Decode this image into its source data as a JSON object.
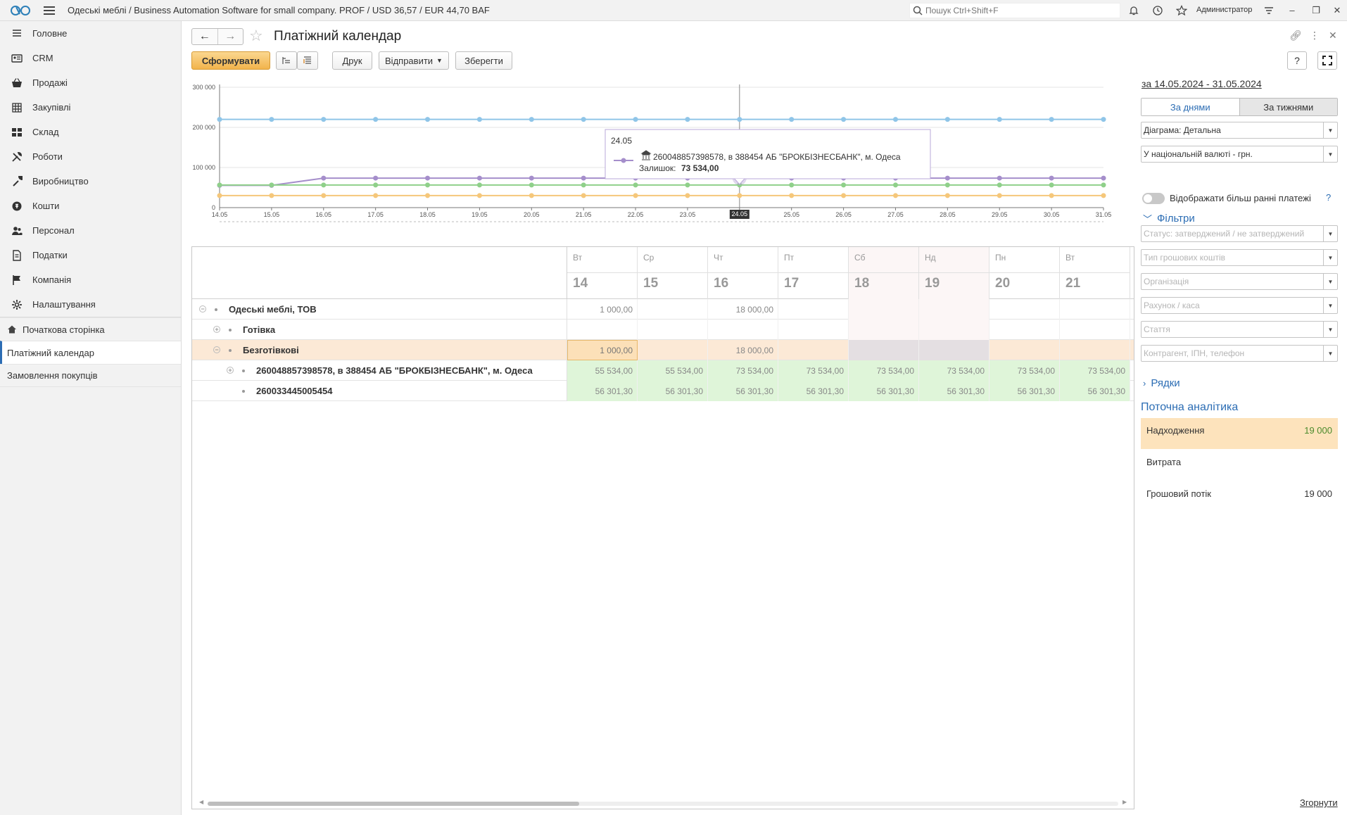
{
  "app": {
    "title": "Одеські меблі / Business Automation Software for small company. PROF / USD 36,57 / EUR 44,70 BAF",
    "search_placeholder": "Пошук Ctrl+Shift+F",
    "user": "Администратор"
  },
  "sidebar": {
    "sections": [
      {
        "label": "Головне",
        "icon": "menu-lines-icon"
      },
      {
        "label": "CRM",
        "icon": "contacts-card-icon"
      },
      {
        "label": "Продажі",
        "icon": "basket-icon"
      },
      {
        "label": "Закупівлі",
        "icon": "purchase-grid-icon"
      },
      {
        "label": "Склад",
        "icon": "warehouse-grid-icon"
      },
      {
        "label": "Роботи",
        "icon": "tools-icon"
      },
      {
        "label": "Виробництво",
        "icon": "production-wrench-icon"
      },
      {
        "label": "Кошти",
        "icon": "money-circle-icon"
      },
      {
        "label": "Персонал",
        "icon": "people-icon"
      },
      {
        "label": "Податки",
        "icon": "tax-document-icon"
      },
      {
        "label": "Компанія",
        "icon": "flag-icon"
      },
      {
        "label": "Налаштування",
        "icon": "gear-icon"
      }
    ],
    "open_windows": [
      {
        "label": "Початкова сторінка",
        "icon": "home-icon"
      },
      {
        "label": "Платіжний календар",
        "active": true
      },
      {
        "label": "Замовлення покупців"
      }
    ]
  },
  "form": {
    "title": "Платіжний календар",
    "buttons": {
      "generate": "Сформувати",
      "print": "Друк",
      "send": "Відправити",
      "save": "Зберегти"
    }
  },
  "chart_data": {
    "type": "line",
    "x": [
      "14.05",
      "15.05",
      "16.05",
      "17.05",
      "18.05",
      "19.05",
      "20.05",
      "21.05",
      "22.05",
      "23.05",
      "24.05",
      "25.05",
      "26.05",
      "27.05",
      "28.05",
      "29.05",
      "30.05",
      "31.05"
    ],
    "ylim": [
      0,
      300000
    ],
    "y_ticks": [
      "300 000",
      "200 000",
      "100 000",
      "0"
    ],
    "y_tick_values": [
      300000,
      200000,
      100000,
      0
    ],
    "highlight_x": "24.05",
    "series": [
      {
        "color": "#8fc5e8",
        "values": [
          220000,
          220000,
          220000,
          220000,
          220000,
          220000,
          220000,
          220000,
          220000,
          220000,
          220000,
          220000,
          220000,
          220000,
          220000,
          220000,
          220000,
          220000
        ]
      },
      {
        "name": "260048857398578, в 388454 АБ \"БРОКБІЗНЕСБАНК\", м. Одеса",
        "color": "#a58ecb",
        "values": [
          55534,
          55534,
          73534,
          73534,
          73534,
          73534,
          73534,
          73534,
          73534,
          73534,
          73534,
          73534,
          73534,
          73534,
          73534,
          73534,
          73534,
          73534
        ]
      },
      {
        "color": "#8fd08a",
        "values": [
          56301,
          56301,
          56301,
          56301,
          56301,
          56301,
          56301,
          56301,
          56301,
          56301,
          56301,
          56301,
          56301,
          56301,
          56301,
          56301,
          56301,
          56301
        ]
      },
      {
        "color": "#f5c77a",
        "values": [
          30000,
          30000,
          30000,
          30000,
          30000,
          30000,
          30000,
          30000,
          30000,
          30000,
          30000,
          30000,
          30000,
          30000,
          30000,
          30000,
          30000,
          30000
        ]
      }
    ],
    "tooltip": {
      "date": "24.05",
      "account": "260048857398578, в 388454 АБ \"БРОКБІЗНЕСБАНК\", м. Одеса",
      "balance_label": "Залишок:",
      "balance_value": "73 534,00"
    }
  },
  "grid": {
    "columns": [
      {
        "dow": "Вт",
        "day": "14"
      },
      {
        "dow": "Ср",
        "day": "15"
      },
      {
        "dow": "Чт",
        "day": "16"
      },
      {
        "dow": "Пт",
        "day": "17"
      },
      {
        "dow": "Сб",
        "day": "18",
        "weekend": true
      },
      {
        "dow": "Нд",
        "day": "19",
        "weekend": true
      },
      {
        "dow": "Пн",
        "day": "20"
      },
      {
        "dow": "Вт",
        "day": "21"
      }
    ],
    "rows": [
      {
        "name": "Одеські меблі, ТОВ",
        "values": [
          "1 000,00",
          "",
          "18 000,00",
          "",
          "",
          "",
          "",
          ""
        ]
      },
      {
        "name": "Готівка",
        "values": [
          "",
          "",
          "",
          "",
          "",
          "",
          "",
          ""
        ]
      },
      {
        "name": "Безготівкові",
        "values": [
          "1 000,00",
          "",
          "18 000,00",
          "",
          "",
          "",
          "",
          ""
        ]
      },
      {
        "name": "260048857398578, в 388454 АБ \"БРОКБІЗНЕСБАНК\", м. Одеса",
        "values": [
          "55 534,00",
          "55 534,00",
          "73 534,00",
          "73 534,00",
          "73 534,00",
          "73 534,00",
          "73 534,00",
          "73 534,00"
        ]
      },
      {
        "name": "260033445005454",
        "values": [
          "56 301,30",
          "56 301,30",
          "56 301,30",
          "56 301,30",
          "56 301,30",
          "56 301,30",
          "56 301,30",
          "56 301,30"
        ]
      }
    ]
  },
  "right_panel": {
    "period": "за 14.05.2024 - 31.05.2024",
    "by_days": "За днями",
    "by_weeks": "За тижнями",
    "diagram": "Діаграма: Детальна",
    "currency": "У національній валюті - грн.",
    "show_earlier": "Відображати більш ранні платежі",
    "help": "?",
    "filters_title": "Фільтри",
    "filters": [
      "Статус: затверджений / не затверджений",
      "Тип грошових коштів",
      "Організація",
      "Рахунок / каса",
      "Стаття",
      "Контрагент, ІПН, телефон"
    ],
    "rows_title": "Рядки",
    "analytics_title": "Поточна аналітика",
    "analytics": [
      {
        "label": "Надходження",
        "value": "19 000"
      },
      {
        "label": "Витрата",
        "value": ""
      },
      {
        "label": "Грошовий потік",
        "value": "19 000"
      }
    ],
    "collapse": "Згорнути"
  }
}
